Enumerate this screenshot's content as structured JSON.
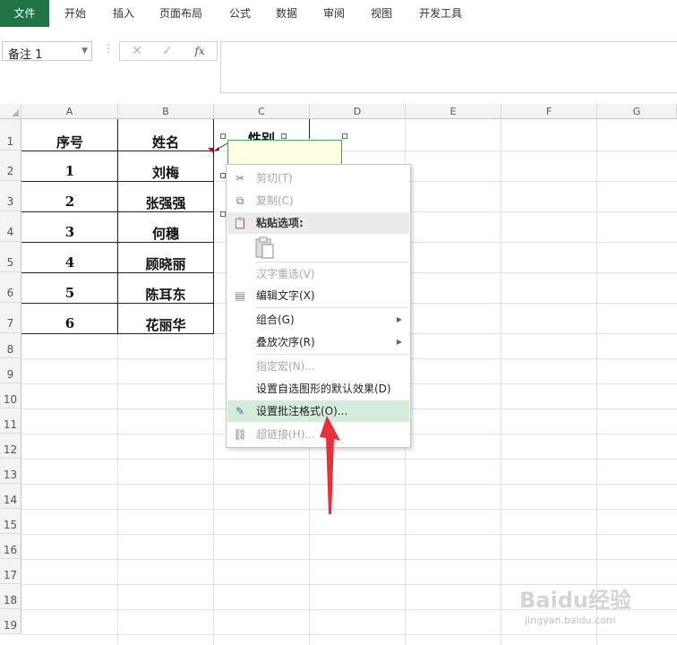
{
  "ribbon": {
    "tabs": [
      "文件",
      "开始",
      "插入",
      "页面布局",
      "公式",
      "数据",
      "审阅",
      "视图",
      "开发工具"
    ]
  },
  "formula_bar": {
    "name_box": "备注 1",
    "fx_label": "fx",
    "formula": ""
  },
  "sheet": {
    "columns": [
      "A",
      "B",
      "C",
      "D",
      "E",
      "F",
      "G"
    ],
    "rows": [
      "1",
      "2",
      "3",
      "4",
      "5",
      "6",
      "7",
      "8",
      "9",
      "10",
      "11",
      "12",
      "13",
      "14",
      "15",
      "16",
      "17",
      "18",
      "19"
    ],
    "header_row": {
      "a": "序号",
      "b": "姓名",
      "c": "性别"
    },
    "data": [
      {
        "a": "1",
        "b": "刘梅"
      },
      {
        "a": "2",
        "b": "张强强"
      },
      {
        "a": "3",
        "b": "何穗"
      },
      {
        "a": "4",
        "b": "顾晓丽"
      },
      {
        "a": "5",
        "b": "陈耳东"
      },
      {
        "a": "6",
        "b": "花丽华"
      }
    ]
  },
  "context_menu": {
    "items": [
      {
        "label": "剪切(T)",
        "icon": "scissors-icon",
        "disabled": true
      },
      {
        "label": "复制(C)",
        "icon": "copy-icon",
        "disabled": true
      },
      {
        "label": "粘贴选项:",
        "icon": "paste-icon",
        "header": true
      },
      {
        "label": "汉字重选(V)",
        "disabled": true
      },
      {
        "label": "编辑文字(X)",
        "icon": "edit-text-icon"
      },
      {
        "label": "组合(G)",
        "submenu": true
      },
      {
        "label": "叠放次序(R)",
        "submenu": true
      },
      {
        "label": "指定宏(N)...",
        "disabled": true
      },
      {
        "label": "设置自选图形的默认效果(D)"
      },
      {
        "label": "设置批注格式(O)...",
        "icon": "format-comment-icon",
        "highlighted": true
      },
      {
        "label": "超链接(H)...",
        "icon": "hyperlink-icon",
        "disabled": true
      }
    ]
  },
  "watermark": {
    "text": "Baidu经验",
    "url_text": "jingyan.baidu.com"
  },
  "colors": {
    "file_tab": "#217346",
    "highlight": "#d4ecd9",
    "arrow": "#e8303a",
    "comment_bg": "#ffffe1"
  }
}
